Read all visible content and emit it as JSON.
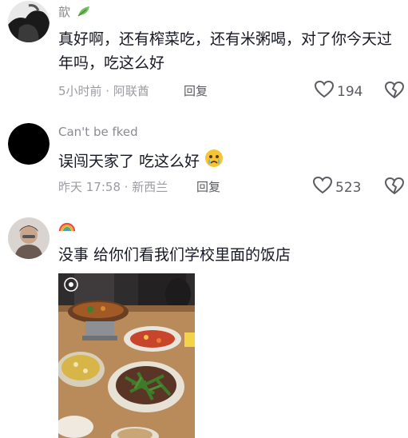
{
  "comments": [
    {
      "username": "歆",
      "username_badge": "leaf-icon",
      "text": "真好啊，还有榨菜吃，还有米粥喝，对了你今天过年吗，吃这么好",
      "time_location": "5小时前 · 阿联酋",
      "reply_label": "回复",
      "likes": "194"
    },
    {
      "username": "Can't be fked",
      "text": "误闯天家了 吃这么好",
      "emoji": "crying-face-emoji",
      "time_location": "昨天 17:58 · 新西兰",
      "reply_label": "回复",
      "likes": "523"
    },
    {
      "username_badge": "rainbow-icon",
      "text": "没事 给你们看我们学校里面的饭店",
      "attachment": "photo-of-restaurant-dishes"
    }
  ]
}
